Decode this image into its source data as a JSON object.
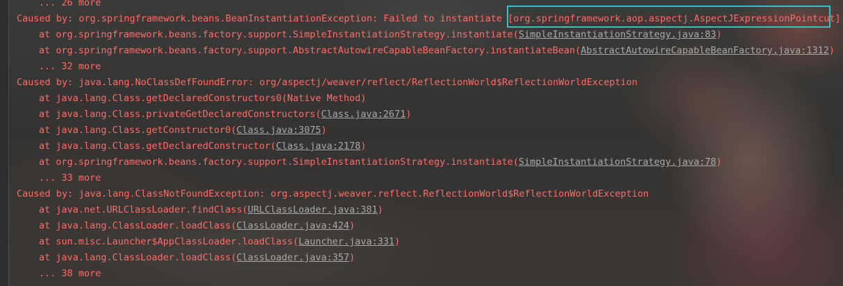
{
  "console": {
    "lines": [
      {
        "kind": "more",
        "text": "... 26 more"
      },
      {
        "kind": "caused",
        "text": "Caused by: org.springframework.beans.BeanInstantiationException: Failed to instantiate [org.springframework.aop.aspectj.AspectJExpressionPointcut]: N"
      },
      {
        "kind": "at",
        "prefix": "at org.springframework.beans.factory.support.SimpleInstantiationStrategy.instantiate(",
        "link": "SimpleInstantiationStrategy.java:83",
        "suffix": ")"
      },
      {
        "kind": "at",
        "prefix": "at org.springframework.beans.factory.support.AbstractAutowireCapableBeanFactory.instantiateBean(",
        "link": "AbstractAutowireCapableBeanFactory.java:1312",
        "suffix": ")"
      },
      {
        "kind": "more",
        "text": "... 32 more"
      },
      {
        "kind": "caused",
        "text": "Caused by: java.lang.NoClassDefFoundError: org/aspectj/weaver/reflect/ReflectionWorld$ReflectionWorldException"
      },
      {
        "kind": "at",
        "prefix": "at java.lang.Class.getDeclaredConstructors0(Native Method)",
        "link": "",
        "suffix": ""
      },
      {
        "kind": "at",
        "prefix": "at java.lang.Class.privateGetDeclaredConstructors(",
        "link": "Class.java:2671",
        "suffix": ")"
      },
      {
        "kind": "at",
        "prefix": "at java.lang.Class.getConstructor0(",
        "link": "Class.java:3075",
        "suffix": ")"
      },
      {
        "kind": "at",
        "prefix": "at java.lang.Class.getDeclaredConstructor(",
        "link": "Class.java:2178",
        "suffix": ")"
      },
      {
        "kind": "at",
        "prefix": "at org.springframework.beans.factory.support.SimpleInstantiationStrategy.instantiate(",
        "link": "SimpleInstantiationStrategy.java:78",
        "suffix": ")"
      },
      {
        "kind": "more",
        "text": "... 33 more"
      },
      {
        "kind": "caused",
        "text": "Caused by: java.lang.ClassNotFoundException: org.aspectj.weaver.reflect.ReflectionWorld$ReflectionWorldException"
      },
      {
        "kind": "at",
        "prefix": "at java.net.URLClassLoader.findClass(",
        "link": "URLClassLoader.java:381",
        "suffix": ")"
      },
      {
        "kind": "at",
        "prefix": "at java.lang.ClassLoader.loadClass(",
        "link": "ClassLoader.java:424",
        "suffix": ")"
      },
      {
        "kind": "at",
        "prefix": "at sun.misc.Launcher$AppClassLoader.loadClass(",
        "link": "Launcher.java:331",
        "suffix": ")"
      },
      {
        "kind": "at",
        "prefix": "at java.lang.ClassLoader.loadClass(",
        "link": "ClassLoader.java:357",
        "suffix": ")"
      },
      {
        "kind": "more",
        "text": "... 38 more"
      }
    ]
  },
  "colors": {
    "error_text": "#ff6b68",
    "link_text": "#a9a9a9",
    "highlight_border": "#35c2c6"
  }
}
